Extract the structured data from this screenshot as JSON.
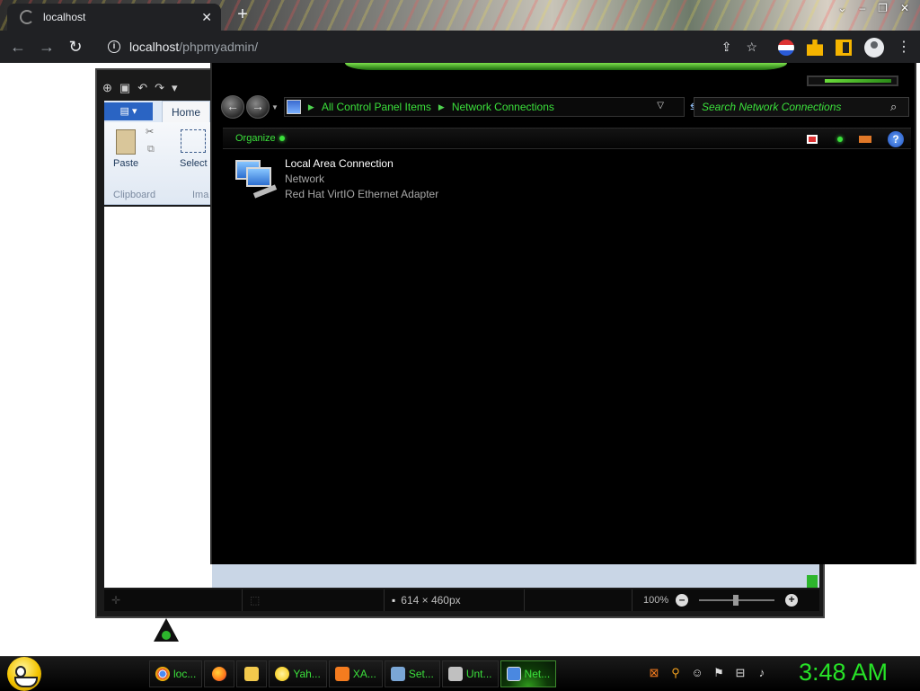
{
  "browser": {
    "tab_title": "localhost",
    "tab_close": "✕",
    "new_tab": "+",
    "window_controls": [
      "⌄",
      "–",
      "❐",
      "✕"
    ],
    "url_host": "localhost",
    "url_path": "/phpmyadmin/",
    "info_icon": "i",
    "nav": {
      "back": "←",
      "forward": "→",
      "reload": "↻"
    },
    "share_icon": "⇪",
    "star_icon": "☆",
    "menu_icon": "⋮"
  },
  "paint": {
    "qat": [
      "⊕",
      "▣",
      "↶",
      "↷",
      "▾"
    ],
    "file_menu": "▤ ▾",
    "home_tab": "Home",
    "paste_label": "Paste",
    "select_label": "Select",
    "clipboard_group": "Clipboard",
    "image_group": "Ima",
    "status_dimensions": "614 × 460px",
    "zoom_level": "100%",
    "zoom_minus": "–",
    "zoom_plus": "+"
  },
  "network_window": {
    "breadcrumb": [
      "All Control Panel Items",
      "Network Connections"
    ],
    "breadcrumb_sep": "▶",
    "back_icon": "←",
    "forward_icon": "→",
    "nav_drop": "▼",
    "bc_drop": "▽",
    "refresh_icon": "⇆",
    "search_placeholder": "Search Network Connections",
    "search_icon": "⌕",
    "organize_label": "Organize",
    "help_label": "?",
    "connection": {
      "name": "Local Area Connection",
      "status": "Network",
      "adapter": "Red Hat VirtIO Ethernet Adapter"
    }
  },
  "taskbar": {
    "tasks": [
      {
        "label": "loc...",
        "icon": "chrome-icon",
        "color": "#e04a3a"
      },
      {
        "label": "",
        "icon": "firefox-icon",
        "color": "#ff7a1a"
      },
      {
        "label": "",
        "icon": "folder-icon",
        "color": "#f2c94c"
      },
      {
        "label": "Yah...",
        "icon": "yahoo-icon",
        "color": "#f4c400"
      },
      {
        "label": "XA...",
        "icon": "xampp-icon",
        "color": "#f57c1f"
      },
      {
        "label": "Set...",
        "icon": "settings-icon",
        "color": "#7aa6d6"
      },
      {
        "label": "Unt...",
        "icon": "paint-icon",
        "color": "#c0c0c0"
      },
      {
        "label": "Net...",
        "icon": "network-icon",
        "color": "#4a88e0"
      }
    ],
    "tray": [
      "⊠",
      "⚲",
      "☺",
      "⚑",
      "⊟",
      "♪"
    ],
    "clock": "3:48 AM"
  },
  "colors": {
    "accent_green": "#3be03b",
    "clock_green": "#27e227"
  }
}
